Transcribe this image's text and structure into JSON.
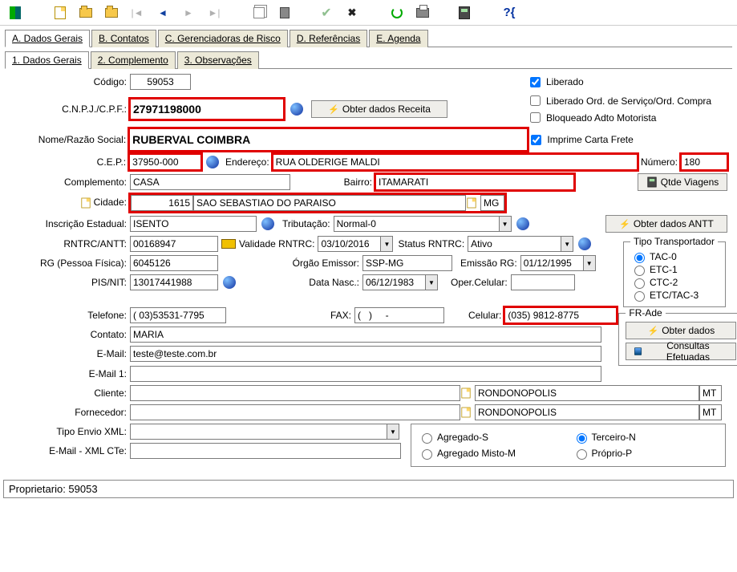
{
  "tabs": {
    "main": [
      "A. Dados Gerais",
      "B. Contatos",
      "C. Gerenciadoras de Risco",
      "D. Referências",
      "E. Agenda"
    ],
    "sub": [
      "1. Dados Gerais",
      "2. Complemento",
      "3. Observações"
    ]
  },
  "labels": {
    "codigo": "Código:",
    "cnpj": "C.N.P.J./C.P.F.:",
    "nome": "Nome/Razão Social:",
    "cep": "C.E.P.:",
    "endereco": "Endereço:",
    "numero": "Número:",
    "complemento": "Complemento:",
    "bairro": "Bairro:",
    "cidade": "Cidade:",
    "inscricao": "Inscrição Estadual:",
    "tributacao": "Tributação:",
    "rntrc": "RNTRC/ANTT:",
    "validade": "Validade RNTRC:",
    "status_rntrc": "Status RNTRC:",
    "rg": "RG (Pessoa Física):",
    "orgao": "Órgão Emissor:",
    "emissao_rg": "Emissão RG:",
    "pis": "PIS/NIT:",
    "data_nasc": "Data Nasc.:",
    "oper_celular": "Oper.Celular:",
    "telefone": "Telefone:",
    "fax": "FAX:",
    "celular": "Celular:",
    "contato": "Contato:",
    "email": "E-Mail:",
    "email1": "E-Mail 1:",
    "cliente": "Cliente:",
    "fornecedor": "Fornecedor:",
    "tipo_envio": "Tipo Envio XML:",
    "email_xml": "E-Mail - XML CTe:"
  },
  "values": {
    "codigo": "59053",
    "cnpj": "27971198000",
    "nome": "RUBERVAL COIMBRA",
    "cep": "37950-000",
    "endereco": "RUA OLDERIGE MALDI",
    "numero": "180",
    "complemento": "CASA",
    "bairro": "ITAMARATI",
    "cidade_cod": "1615",
    "cidade_nome": "SAO SEBASTIAO DO PARAISO",
    "cidade_uf": "MG",
    "inscricao": "ISENTO",
    "tributacao": "Normal-0",
    "rntrc": "00168947",
    "validade": "03/10/2016",
    "status_rntrc": "Ativo",
    "rg": "6045126",
    "orgao": "SSP-MG",
    "emissao_rg": "01/12/1995",
    "pis": "13017441988",
    "data_nasc": "06/12/1983",
    "oper_celular": "",
    "telefone": "( 03)53531-7795",
    "fax": "(   )     -",
    "celular": "(035) 9812-8775",
    "contato": "MARIA",
    "email": "teste@teste.com.br",
    "email1": "",
    "cliente_cod": "",
    "cliente_nome": "RONDONOPOLIS",
    "cliente_uf": "MT",
    "fornecedor_cod": "",
    "fornecedor_nome": "RONDONOPOLIS",
    "fornecedor_uf": "MT",
    "tipo_envio": "",
    "email_xml": ""
  },
  "buttons": {
    "obter_receita": "Obter dados Receita",
    "qtde_viagens": "Qtde Viagens",
    "obter_antt": "Obter dados ANTT",
    "obter_dados": "Obter dados",
    "consultas": "Consultas Efetuadas"
  },
  "checks": {
    "liberado": "Liberado",
    "liberado_ord": "Liberado Ord. de Serviço/Ord. Compra",
    "bloqueado": "Bloqueado Adto Motorista",
    "imprime": "Imprime Carta Frete"
  },
  "groups": {
    "tipo_transportador": {
      "legend": "Tipo Transportador",
      "options": [
        "TAC-0",
        "ETC-1",
        "CTC-2",
        "ETC/TAC-3"
      ]
    },
    "frade": {
      "legend": "FR-Ade"
    },
    "vinculo": {
      "options": [
        "Agregado-S",
        "Terceiro-N",
        "Agregado Misto-M",
        "Próprio-P"
      ]
    }
  },
  "statusbar": "Proprietario: 59053"
}
